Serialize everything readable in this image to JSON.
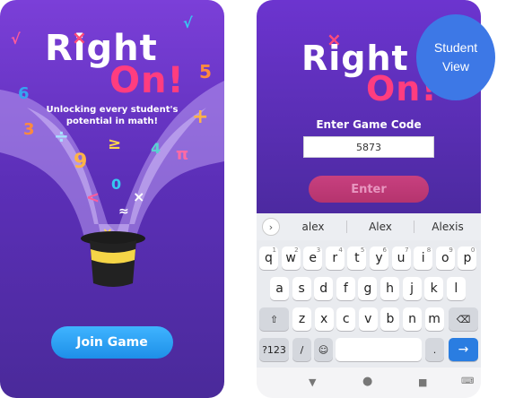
{
  "left_screen": {
    "logo_word1": "Right",
    "logo_word2": "On!",
    "tagline_line1": "Unlocking every student's",
    "tagline_line2": "potential in math!",
    "join_button": "Join Game"
  },
  "right_screen": {
    "logo_word1": "Right",
    "logo_word2": "On!",
    "game_code_label": "Enter Game Code",
    "game_code_value": "5873",
    "enter_button": "Enter",
    "badge_line1": "Student",
    "badge_line2": "View"
  },
  "keyboard": {
    "suggestions": [
      "alex",
      "Alex",
      "Alexis"
    ],
    "row1": [
      "q",
      "w",
      "e",
      "r",
      "t",
      "y",
      "u",
      "i",
      "o",
      "p"
    ],
    "row1_hints": [
      "1",
      "2",
      "3",
      "4",
      "5",
      "6",
      "7",
      "8",
      "9",
      "0"
    ],
    "row2": [
      "a",
      "s",
      "d",
      "f",
      "g",
      "h",
      "j",
      "k",
      "l"
    ],
    "row3": [
      "z",
      "x",
      "c",
      "v",
      "b",
      "n",
      "m"
    ],
    "mode_key": "?123",
    "slash_key": "/",
    "period_key": "."
  },
  "icons": [
    "shift-icon",
    "backspace-icon",
    "emoji-icon",
    "enter-arrow-icon",
    "chevron-right-icon",
    "nav-back-icon",
    "nav-home-icon",
    "nav-recents-icon",
    "nav-keyboard-icon",
    "top-hat-icon"
  ],
  "colors": {
    "purple": "#6c34cf",
    "pink": "#ff3d7f",
    "blue": "#2a7de1",
    "join_blue": "#3fb4ff"
  }
}
